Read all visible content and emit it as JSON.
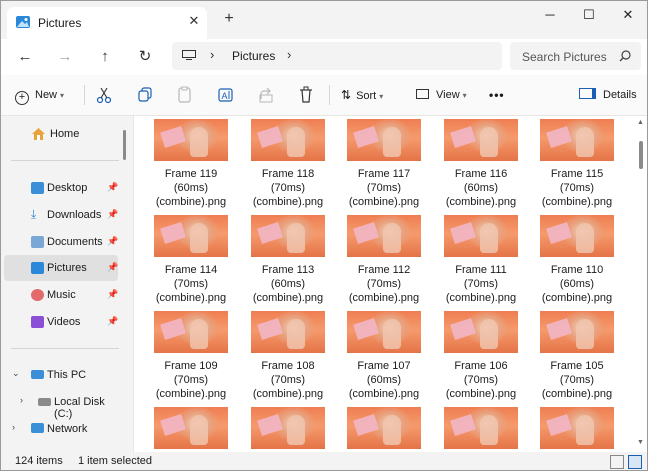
{
  "window": {
    "tab_title": "Pictures",
    "tab_close": "✕",
    "new_tab": "+",
    "minimize": "─",
    "maximize": "☐",
    "close": "✕"
  },
  "nav": {
    "back": "←",
    "forward": "→",
    "up": "↑",
    "refresh": "↻",
    "breadcrumb_sep": "›",
    "location": "Pictures",
    "search_placeholder": "Search Pictures"
  },
  "toolbar": {
    "new_label": "New",
    "sort_label": "Sort",
    "view_label": "View",
    "more_label": "•••",
    "details_label": "Details"
  },
  "sidebar": {
    "home": "Home",
    "quick_access": [
      {
        "label": "Desktop",
        "icon": "desktop-icon"
      },
      {
        "label": "Downloads",
        "icon": "downloads-icon"
      },
      {
        "label": "Documents",
        "icon": "documents-icon"
      },
      {
        "label": "Pictures",
        "icon": "pictures-icon",
        "selected": true
      },
      {
        "label": "Music",
        "icon": "music-icon"
      },
      {
        "label": "Videos",
        "icon": "videos-icon"
      }
    ],
    "tree": [
      {
        "label": "This PC",
        "expanded": true
      },
      {
        "label": "Local Disk (C:)",
        "expanded": false
      },
      {
        "label": "Network",
        "expanded": false
      }
    ]
  },
  "files": [
    {
      "l1": "Frame 119",
      "l2": "(60ms)",
      "l3": "(combine).png"
    },
    {
      "l1": "Frame 118",
      "l2": "(70ms)",
      "l3": "(combine).png"
    },
    {
      "l1": "Frame 117",
      "l2": "(70ms)",
      "l3": "(combine).png"
    },
    {
      "l1": "Frame 116",
      "l2": "(60ms)",
      "l3": "(combine).png"
    },
    {
      "l1": "Frame 115",
      "l2": "(70ms)",
      "l3": "(combine).png"
    },
    {
      "l1": "Frame 114",
      "l2": "(70ms)",
      "l3": "(combine).png"
    },
    {
      "l1": "Frame 113",
      "l2": "(60ms)",
      "l3": "(combine).png"
    },
    {
      "l1": "Frame 112",
      "l2": "(70ms)",
      "l3": "(combine).png"
    },
    {
      "l1": "Frame 111",
      "l2": "(70ms)",
      "l3": "(combine).png"
    },
    {
      "l1": "Frame 110",
      "l2": "(60ms)",
      "l3": "(combine).png"
    },
    {
      "l1": "Frame 109",
      "l2": "(70ms)",
      "l3": "(combine).png"
    },
    {
      "l1": "Frame 108",
      "l2": "(70ms)",
      "l3": "(combine).png"
    },
    {
      "l1": "Frame 107",
      "l2": "(60ms)",
      "l3": "(combine).png"
    },
    {
      "l1": "Frame 106",
      "l2": "(70ms)",
      "l3": "(combine).png"
    },
    {
      "l1": "Frame 105",
      "l2": "(70ms)",
      "l3": "(combine).png"
    },
    {
      "l1": "",
      "l2": "",
      "l3": ""
    },
    {
      "l1": "",
      "l2": "",
      "l3": ""
    },
    {
      "l1": "",
      "l2": "",
      "l3": ""
    },
    {
      "l1": "",
      "l2": "",
      "l3": ""
    },
    {
      "l1": "",
      "l2": "",
      "l3": ""
    }
  ],
  "status": {
    "item_count": "124 items",
    "selection": "1 item selected"
  },
  "colors": {
    "accent": "#0067c0",
    "chrome": "#f3f3f3",
    "selected": "#e0e0e0"
  }
}
